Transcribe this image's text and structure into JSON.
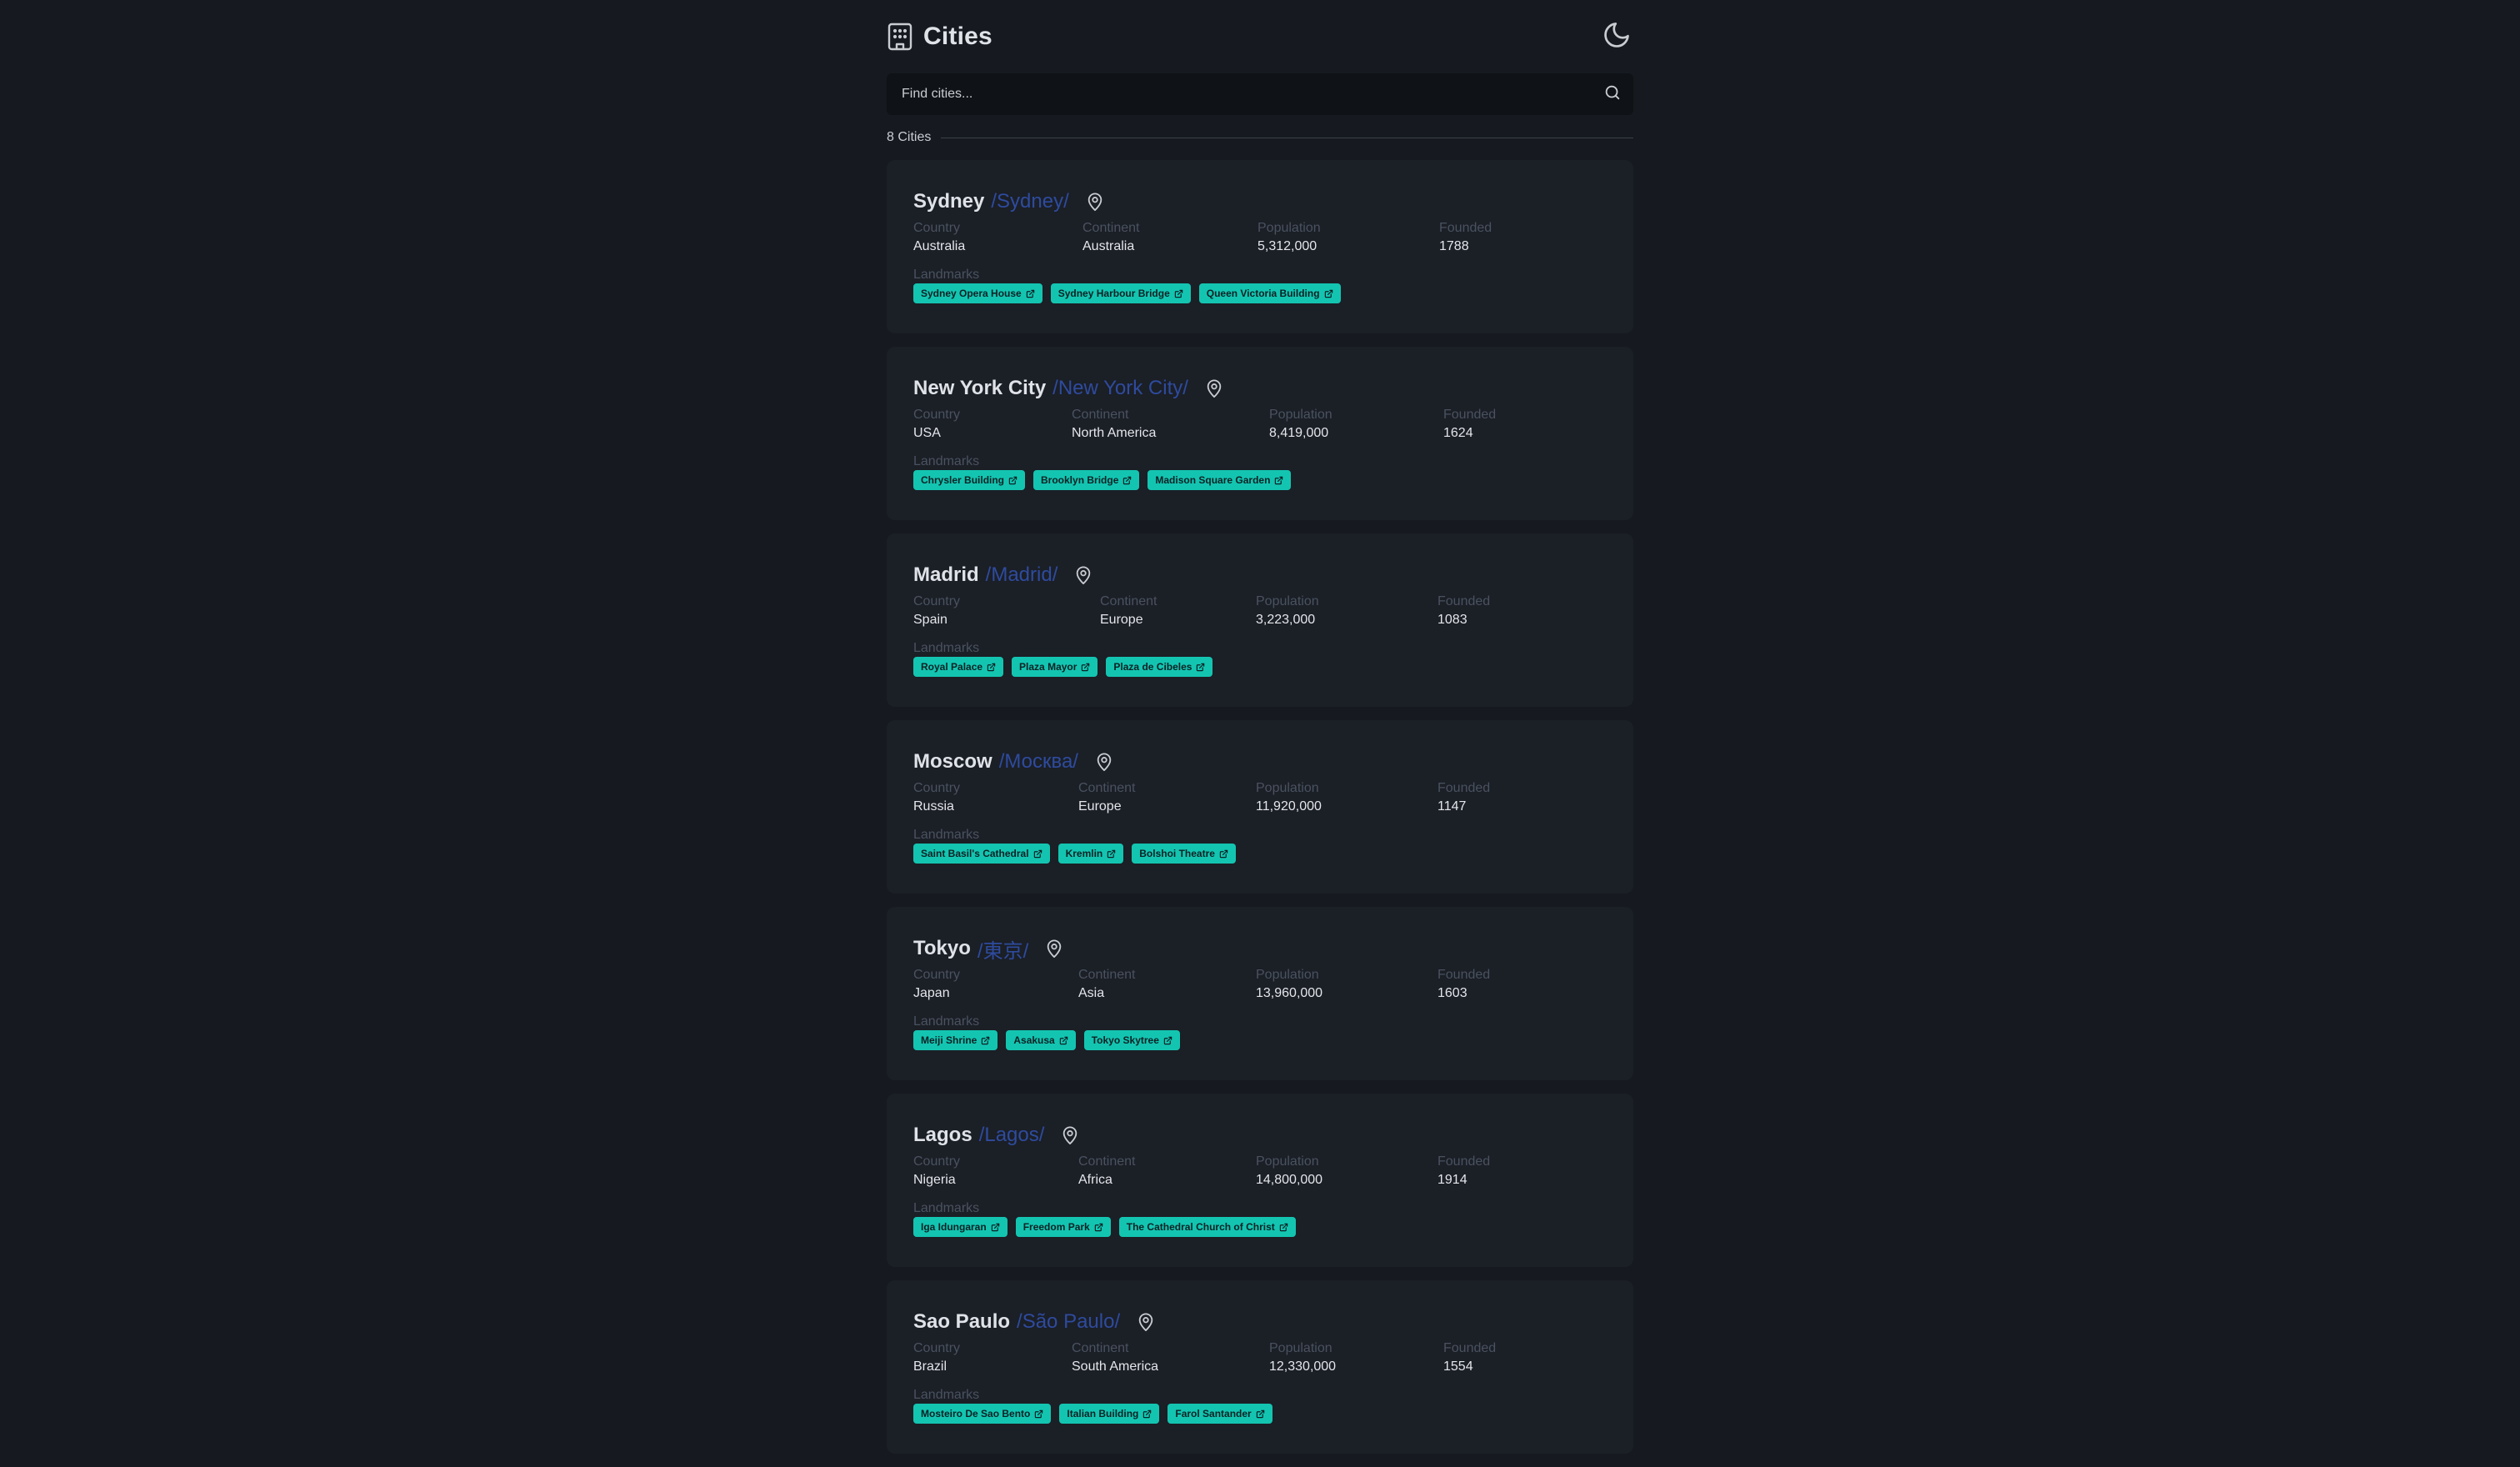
{
  "app": {
    "title": "Cities",
    "search_placeholder": "Find cities...",
    "count_label": "8 Cities"
  },
  "labels": {
    "country": "Country",
    "continent": "Continent",
    "population": "Population",
    "founded": "Founded",
    "landmarks": "Landmarks"
  },
  "colors": {
    "background": "#161a20",
    "card": "#1b1f26",
    "accent_chip": "#13c5b1",
    "native_name": "#2e4b9e"
  },
  "cities": [
    {
      "name": "Sydney",
      "native": "/Sydney/",
      "country": "Australia",
      "continent": "Australia",
      "population": "5,312,000",
      "founded": "1788",
      "landmarks": [
        "Sydney Opera House",
        "Sydney Harbour Bridge",
        "Queen Victoria Building"
      ]
    },
    {
      "name": "New York City",
      "native": "/New York City/",
      "country": "USA",
      "continent": "North America",
      "population": "8,419,000",
      "founded": "1624",
      "landmarks": [
        "Chrysler Building",
        "Brooklyn Bridge",
        "Madison Square Garden"
      ]
    },
    {
      "name": "Madrid",
      "native": "/Madrid/",
      "country": "Spain",
      "continent": "Europe",
      "population": "3,223,000",
      "founded": "1083",
      "landmarks": [
        "Royal Palace",
        "Plaza Mayor",
        "Plaza de Cibeles"
      ]
    },
    {
      "name": "Moscow",
      "native": "/Москва/",
      "country": "Russia",
      "continent": "Europe",
      "population": "11,920,000",
      "founded": "1147",
      "landmarks": [
        "Saint Basil's Cathedral",
        "Kremlin",
        "Bolshoi Theatre"
      ]
    },
    {
      "name": "Tokyo",
      "native": "/東京/",
      "country": "Japan",
      "continent": "Asia",
      "population": "13,960,000",
      "founded": "1603",
      "landmarks": [
        "Meiji Shrine",
        "Asakusa",
        "Tokyo Skytree"
      ]
    },
    {
      "name": "Lagos",
      "native": "/Lagos/",
      "country": "Nigeria",
      "continent": "Africa",
      "population": "14,800,000",
      "founded": "1914",
      "landmarks": [
        "Iga Idungaran",
        "Freedom Park",
        "The Cathedral Church of Christ"
      ]
    },
    {
      "name": "Sao Paulo",
      "native": "/São Paulo/",
      "country": "Brazil",
      "continent": "South America",
      "population": "12,330,000",
      "founded": "1554",
      "landmarks": [
        "Mosteiro De Sao Bento",
        "Italian Building",
        "Farol Santander"
      ]
    }
  ]
}
